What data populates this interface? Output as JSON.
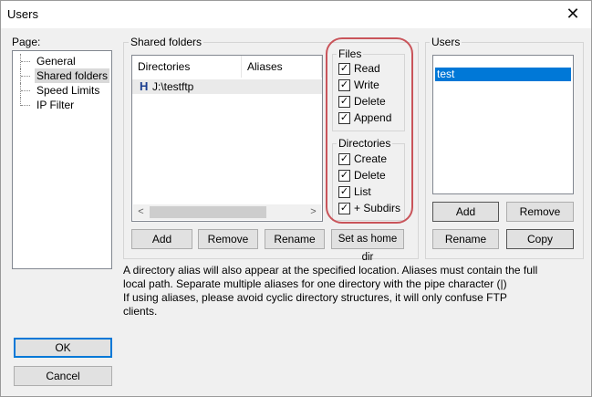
{
  "window": {
    "title": "Users",
    "close_glyph": "✕"
  },
  "page_panel": {
    "label": "Page:",
    "items": [
      {
        "label": "General",
        "selected": false
      },
      {
        "label": "Shared folders",
        "selected": true
      },
      {
        "label": "Speed Limits",
        "selected": false
      },
      {
        "label": "IP Filter",
        "selected": false
      }
    ]
  },
  "shared_folders": {
    "label": "Shared folders",
    "columns": [
      "Directories",
      "Aliases"
    ],
    "rows": [
      {
        "icon": "H",
        "directory": "J:\\testftp",
        "alias": ""
      }
    ],
    "buttons": {
      "add": "Add",
      "remove": "Remove",
      "rename": "Rename",
      "home": "Set as home dir"
    },
    "scroll_left": "<",
    "scroll_right": ">"
  },
  "files": {
    "label": "Files",
    "items": [
      {
        "label": "Read",
        "checked": true
      },
      {
        "label": "Write",
        "checked": true
      },
      {
        "label": "Delete",
        "checked": true
      },
      {
        "label": "Append",
        "checked": true
      }
    ]
  },
  "directories": {
    "label": "Directories",
    "items": [
      {
        "label": "Create",
        "checked": true
      },
      {
        "label": "Delete",
        "checked": true
      },
      {
        "label": "List",
        "checked": true
      },
      {
        "label": "+ Subdirs",
        "checked": true
      }
    ]
  },
  "users": {
    "label": "Users",
    "list": [
      "test"
    ],
    "buttons": {
      "add": "Add",
      "remove": "Remove",
      "rename": "Rename",
      "copy": "Copy"
    }
  },
  "info": {
    "line1": "A directory alias will also appear at the specified location. Aliases must contain the full local path. Separate multiple aliases for one directory with the pipe character (|)",
    "line2": "If using aliases, please avoid cyclic directory structures, it will only confuse FTP clients."
  },
  "footer": {
    "ok": "OK",
    "cancel": "Cancel"
  },
  "colors": {
    "selection": "#0078d7",
    "annotation_ring": "#c9545a"
  }
}
